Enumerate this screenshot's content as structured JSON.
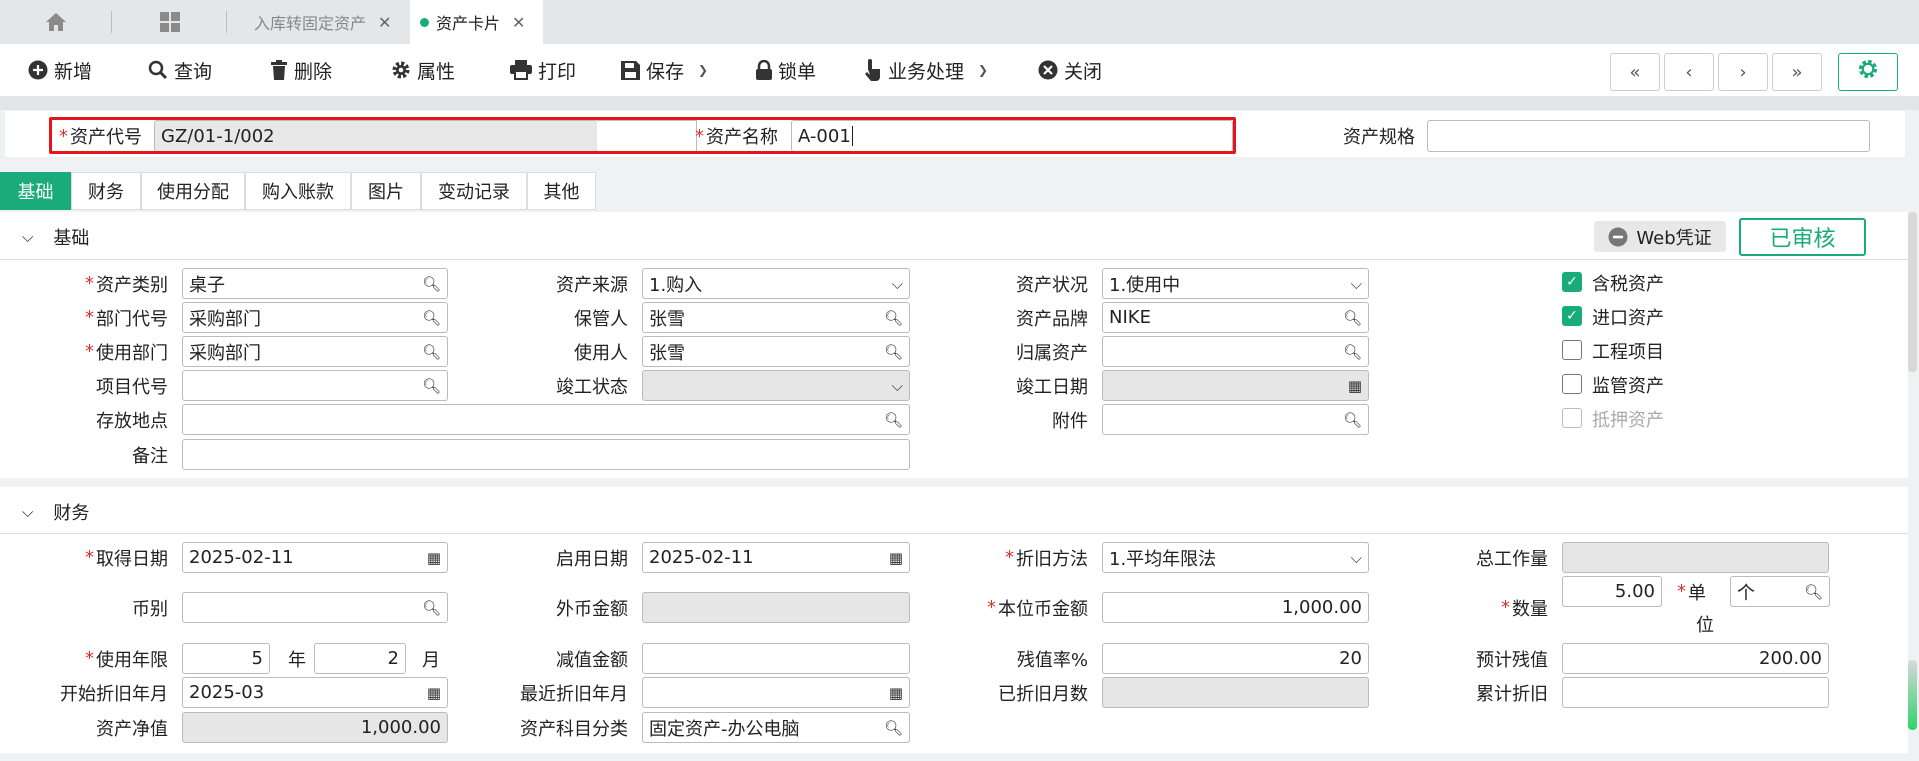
{
  "tabbar": {
    "home_icon": "home-icon",
    "apps_icon": "grid-icon",
    "tabs": [
      {
        "label": "入库转固定资产",
        "close": "✕"
      },
      {
        "label": "资产卡片",
        "close": "✕"
      }
    ]
  },
  "toolbar": {
    "new": "新增",
    "query": "查询",
    "delete": "删除",
    "properties": "属性",
    "print": "打印",
    "save": "保存",
    "lock": "锁单",
    "business": "业务处理",
    "close": "关闭"
  },
  "header": {
    "asset_code_label": "资产代号",
    "asset_code_value": "GZ/01-1/002",
    "asset_name_label": "资产名称",
    "asset_name_value": "A-001",
    "asset_spec_label": "资产规格",
    "asset_spec_value": ""
  },
  "subtabs": [
    "基础",
    "财务",
    "使用分配",
    "购入账款",
    "图片",
    "变动记录",
    "其他"
  ],
  "basic": {
    "title": "基础",
    "web_voucher": "Web凭证",
    "audit_status": "已审核",
    "asset_category_label": "资产类别",
    "asset_category": "桌子",
    "asset_source_label": "资产来源",
    "asset_source": "1.购入",
    "asset_status_label": "资产状况",
    "asset_status": "1.使用中",
    "dept_code_label": "部门代号",
    "dept_code": "采购部门",
    "custodian_label": "保管人",
    "custodian": "张雪",
    "brand_label": "资产品牌",
    "brand": "NIKE",
    "use_dept_label": "使用部门",
    "use_dept": "采购部门",
    "user_label": "使用人",
    "user": "张雪",
    "belong_label": "归属资产",
    "belong": "",
    "project_label": "项目代号",
    "project": "",
    "complete_status_label": "竣工状态",
    "complete_status": "",
    "complete_date_label": "竣工日期",
    "complete_date": "",
    "location_label": "存放地点",
    "location": "",
    "attachment_label": "附件",
    "attachment": "",
    "remark_label": "备注",
    "remark": "",
    "checks": [
      {
        "label": "含税资产",
        "checked": true
      },
      {
        "label": "进口资产",
        "checked": true
      },
      {
        "label": "工程项目",
        "checked": false
      },
      {
        "label": "监管资产",
        "checked": false
      },
      {
        "label": "抵押资产",
        "checked": false
      }
    ]
  },
  "finance": {
    "title": "财务",
    "acq_date_label": "取得日期",
    "acq_date": "2025-02-11",
    "start_date_label": "启用日期",
    "start_date": "2025-02-11",
    "dep_method_label": "折旧方法",
    "dep_method": "1.平均年限法",
    "total_work_label": "总工作量",
    "total_work": "",
    "currency_label": "币别",
    "currency": "",
    "fc_amount_label": "外币金额",
    "fc_amount": "",
    "lc_amount_label": "本位币金额",
    "lc_amount": "1,000.00",
    "qty_label": "数量",
    "qty": "5.00",
    "unit_label_1": "单",
    "unit_label_2": "位",
    "unit": "个",
    "life_label": "使用年限",
    "life_years": "5",
    "years_unit": "年",
    "life_months": "2",
    "months_unit": "月",
    "impairment_label": "减值金额",
    "impairment": "",
    "residual_rate_label": "残值率%",
    "residual_rate": "20",
    "est_residual_label": "预计残值",
    "est_residual": "200.00",
    "dep_start_label": "开始折旧年月",
    "dep_start": "2025-03",
    "last_dep_label": "最近折旧年月",
    "last_dep": "",
    "dep_months_label": "已折旧月数",
    "dep_months": "",
    "accum_dep_label": "累计折旧",
    "accum_dep": "",
    "net_value_label": "资产净值",
    "net_value": "1,000.00",
    "subject_label": "资产科目分类",
    "subject": "固定资产-办公电脑"
  },
  "colors": {
    "accent": "#1aab7a",
    "highlight": "#e8141b",
    "required": "#e0302b"
  }
}
